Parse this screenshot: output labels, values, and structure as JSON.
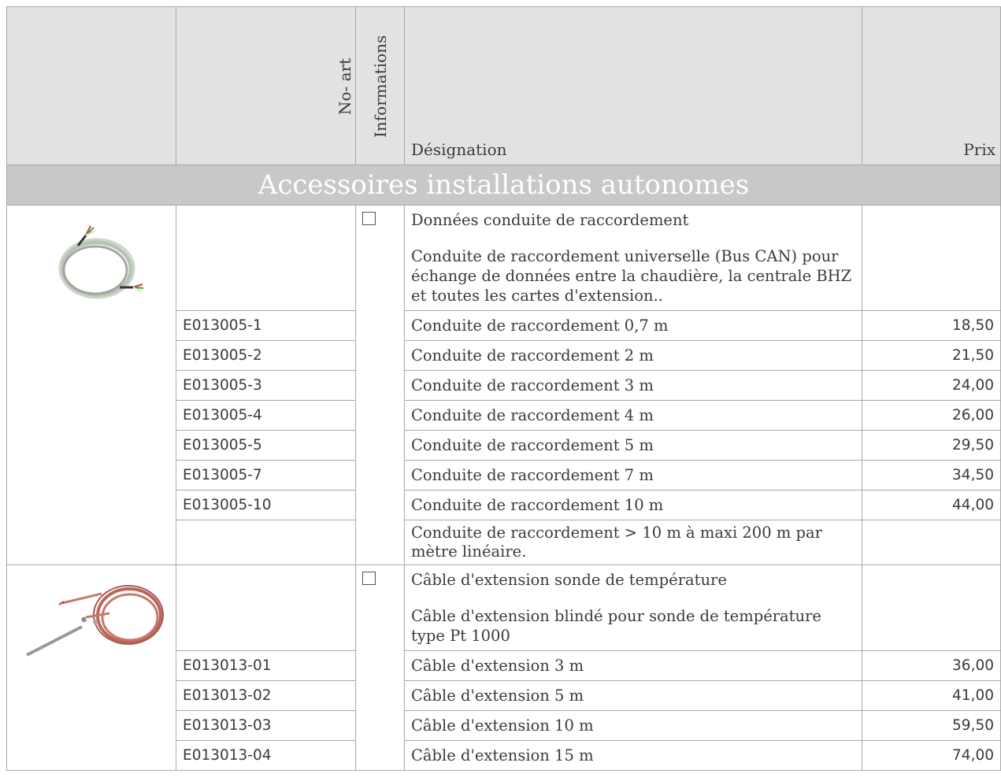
{
  "header": {
    "col_noart": "No- art",
    "col_info": "Informations",
    "col_designation": "Désignation",
    "col_prix": "Prix"
  },
  "section_title": "Accessoires installations autonomes",
  "group1": {
    "image_icon": "coiled-grey-cable-image",
    "title": "Données conduite de raccordement",
    "description": "Conduite de raccordement universelle (Bus CAN) pour échange de données entre la chaudière, la centrale BHZ et toutes les cartes d'extension..",
    "rows": [
      {
        "art": "E013005-1",
        "designation": "Conduite de raccordement 0,7 m",
        "price": "18,50"
      },
      {
        "art": "E013005-2",
        "designation": "Conduite de raccordement 2 m",
        "price": "21,50"
      },
      {
        "art": "E013005-3",
        "designation": "Conduite de raccordement 3 m",
        "price": "24,00"
      },
      {
        "art": "E013005-4",
        "designation": "Conduite de raccordement 4 m",
        "price": "26,00"
      },
      {
        "art": "E013005-5",
        "designation": "Conduite de raccordement 5 m",
        "price": "29,50"
      },
      {
        "art": "E013005-7",
        "designation": "Conduite de raccordement 7 m",
        "price": "34,50"
      },
      {
        "art": "E013005-10",
        "designation": "Conduite de raccordement 10 m",
        "price": "44,00"
      }
    ],
    "extra": "Conduite de raccordement > 10 m à maxi 200 m par mètre linéaire."
  },
  "group2": {
    "image_icon": "temperature-sensor-cable-image",
    "title": "Câble d'extension sonde de température",
    "description": "Câble d'extension blindé pour sonde de température type Pt 1000",
    "rows": [
      {
        "art": "E013013-01",
        "designation": "Câble d'extension 3 m",
        "price": "36,00"
      },
      {
        "art": "E013013-02",
        "designation": "Câble d'extension 5 m",
        "price": "41,00"
      },
      {
        "art": "E013013-03",
        "designation": "Câble d'extension 10 m",
        "price": "59,50"
      },
      {
        "art": "E013013-04",
        "designation": "Câble d'extension 15 m",
        "price": "74,00"
      }
    ]
  }
}
